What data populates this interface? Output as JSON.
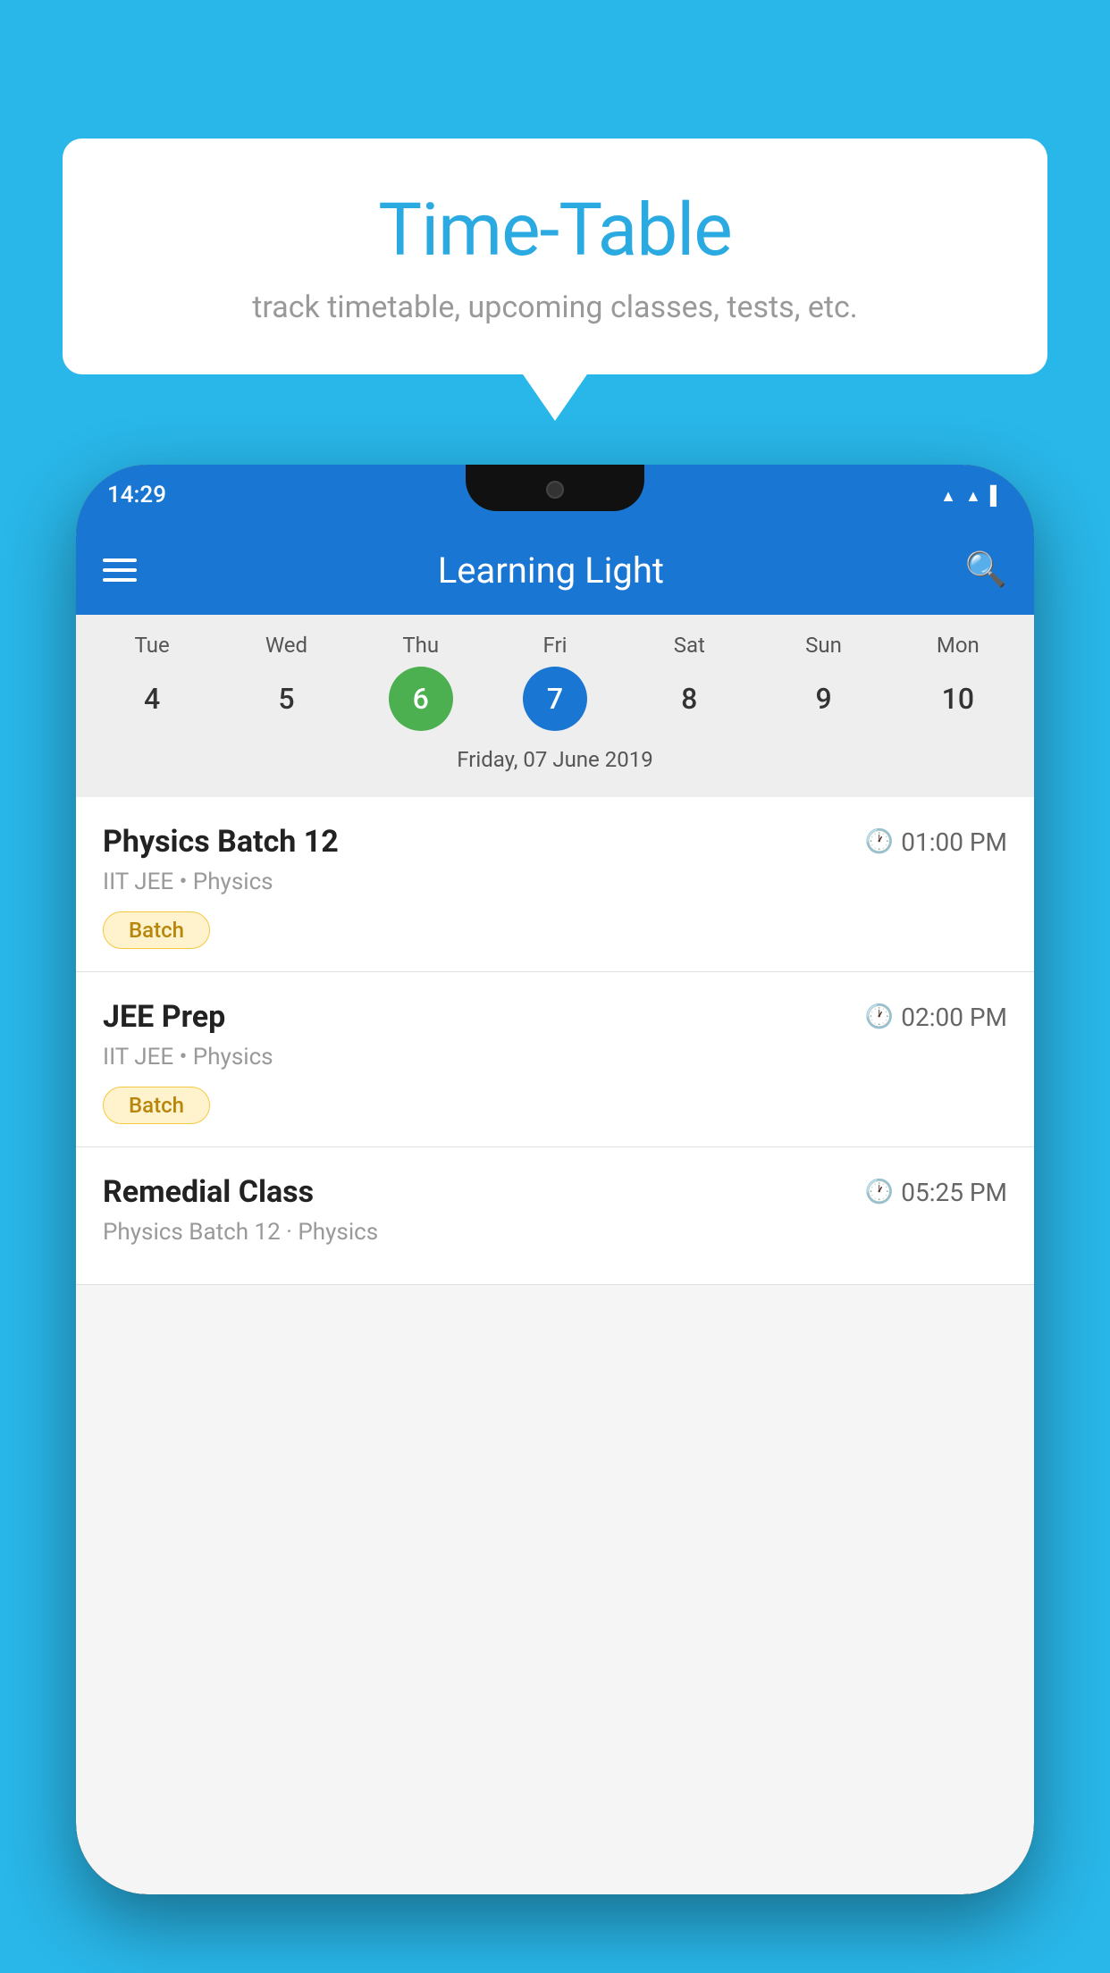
{
  "background_color": "#29b6e8",
  "bubble": {
    "title": "Time-Table",
    "subtitle": "track timetable, upcoming classes, tests, etc."
  },
  "phone": {
    "status_bar": {
      "time": "14:29"
    },
    "app_bar": {
      "title": "Learning Light"
    },
    "calendar": {
      "days": [
        {
          "name": "Tue",
          "num": "4",
          "state": "normal"
        },
        {
          "name": "Wed",
          "num": "5",
          "state": "normal"
        },
        {
          "name": "Thu",
          "num": "6",
          "state": "today"
        },
        {
          "name": "Fri",
          "num": "7",
          "state": "selected"
        },
        {
          "name": "Sat",
          "num": "8",
          "state": "normal"
        },
        {
          "name": "Sun",
          "num": "9",
          "state": "normal"
        },
        {
          "name": "Mon",
          "num": "10",
          "state": "normal"
        }
      ],
      "selected_date_label": "Friday, 07 June 2019"
    },
    "schedule": [
      {
        "title": "Physics Batch 12",
        "time": "01:00 PM",
        "sub": "IIT JEE • Physics",
        "badge": "Batch"
      },
      {
        "title": "JEE Prep",
        "time": "02:00 PM",
        "sub": "IIT JEE • Physics",
        "badge": "Batch"
      },
      {
        "title": "Remedial Class",
        "time": "05:25 PM",
        "sub": "Physics Batch 12 · Physics",
        "badge": null
      }
    ]
  }
}
